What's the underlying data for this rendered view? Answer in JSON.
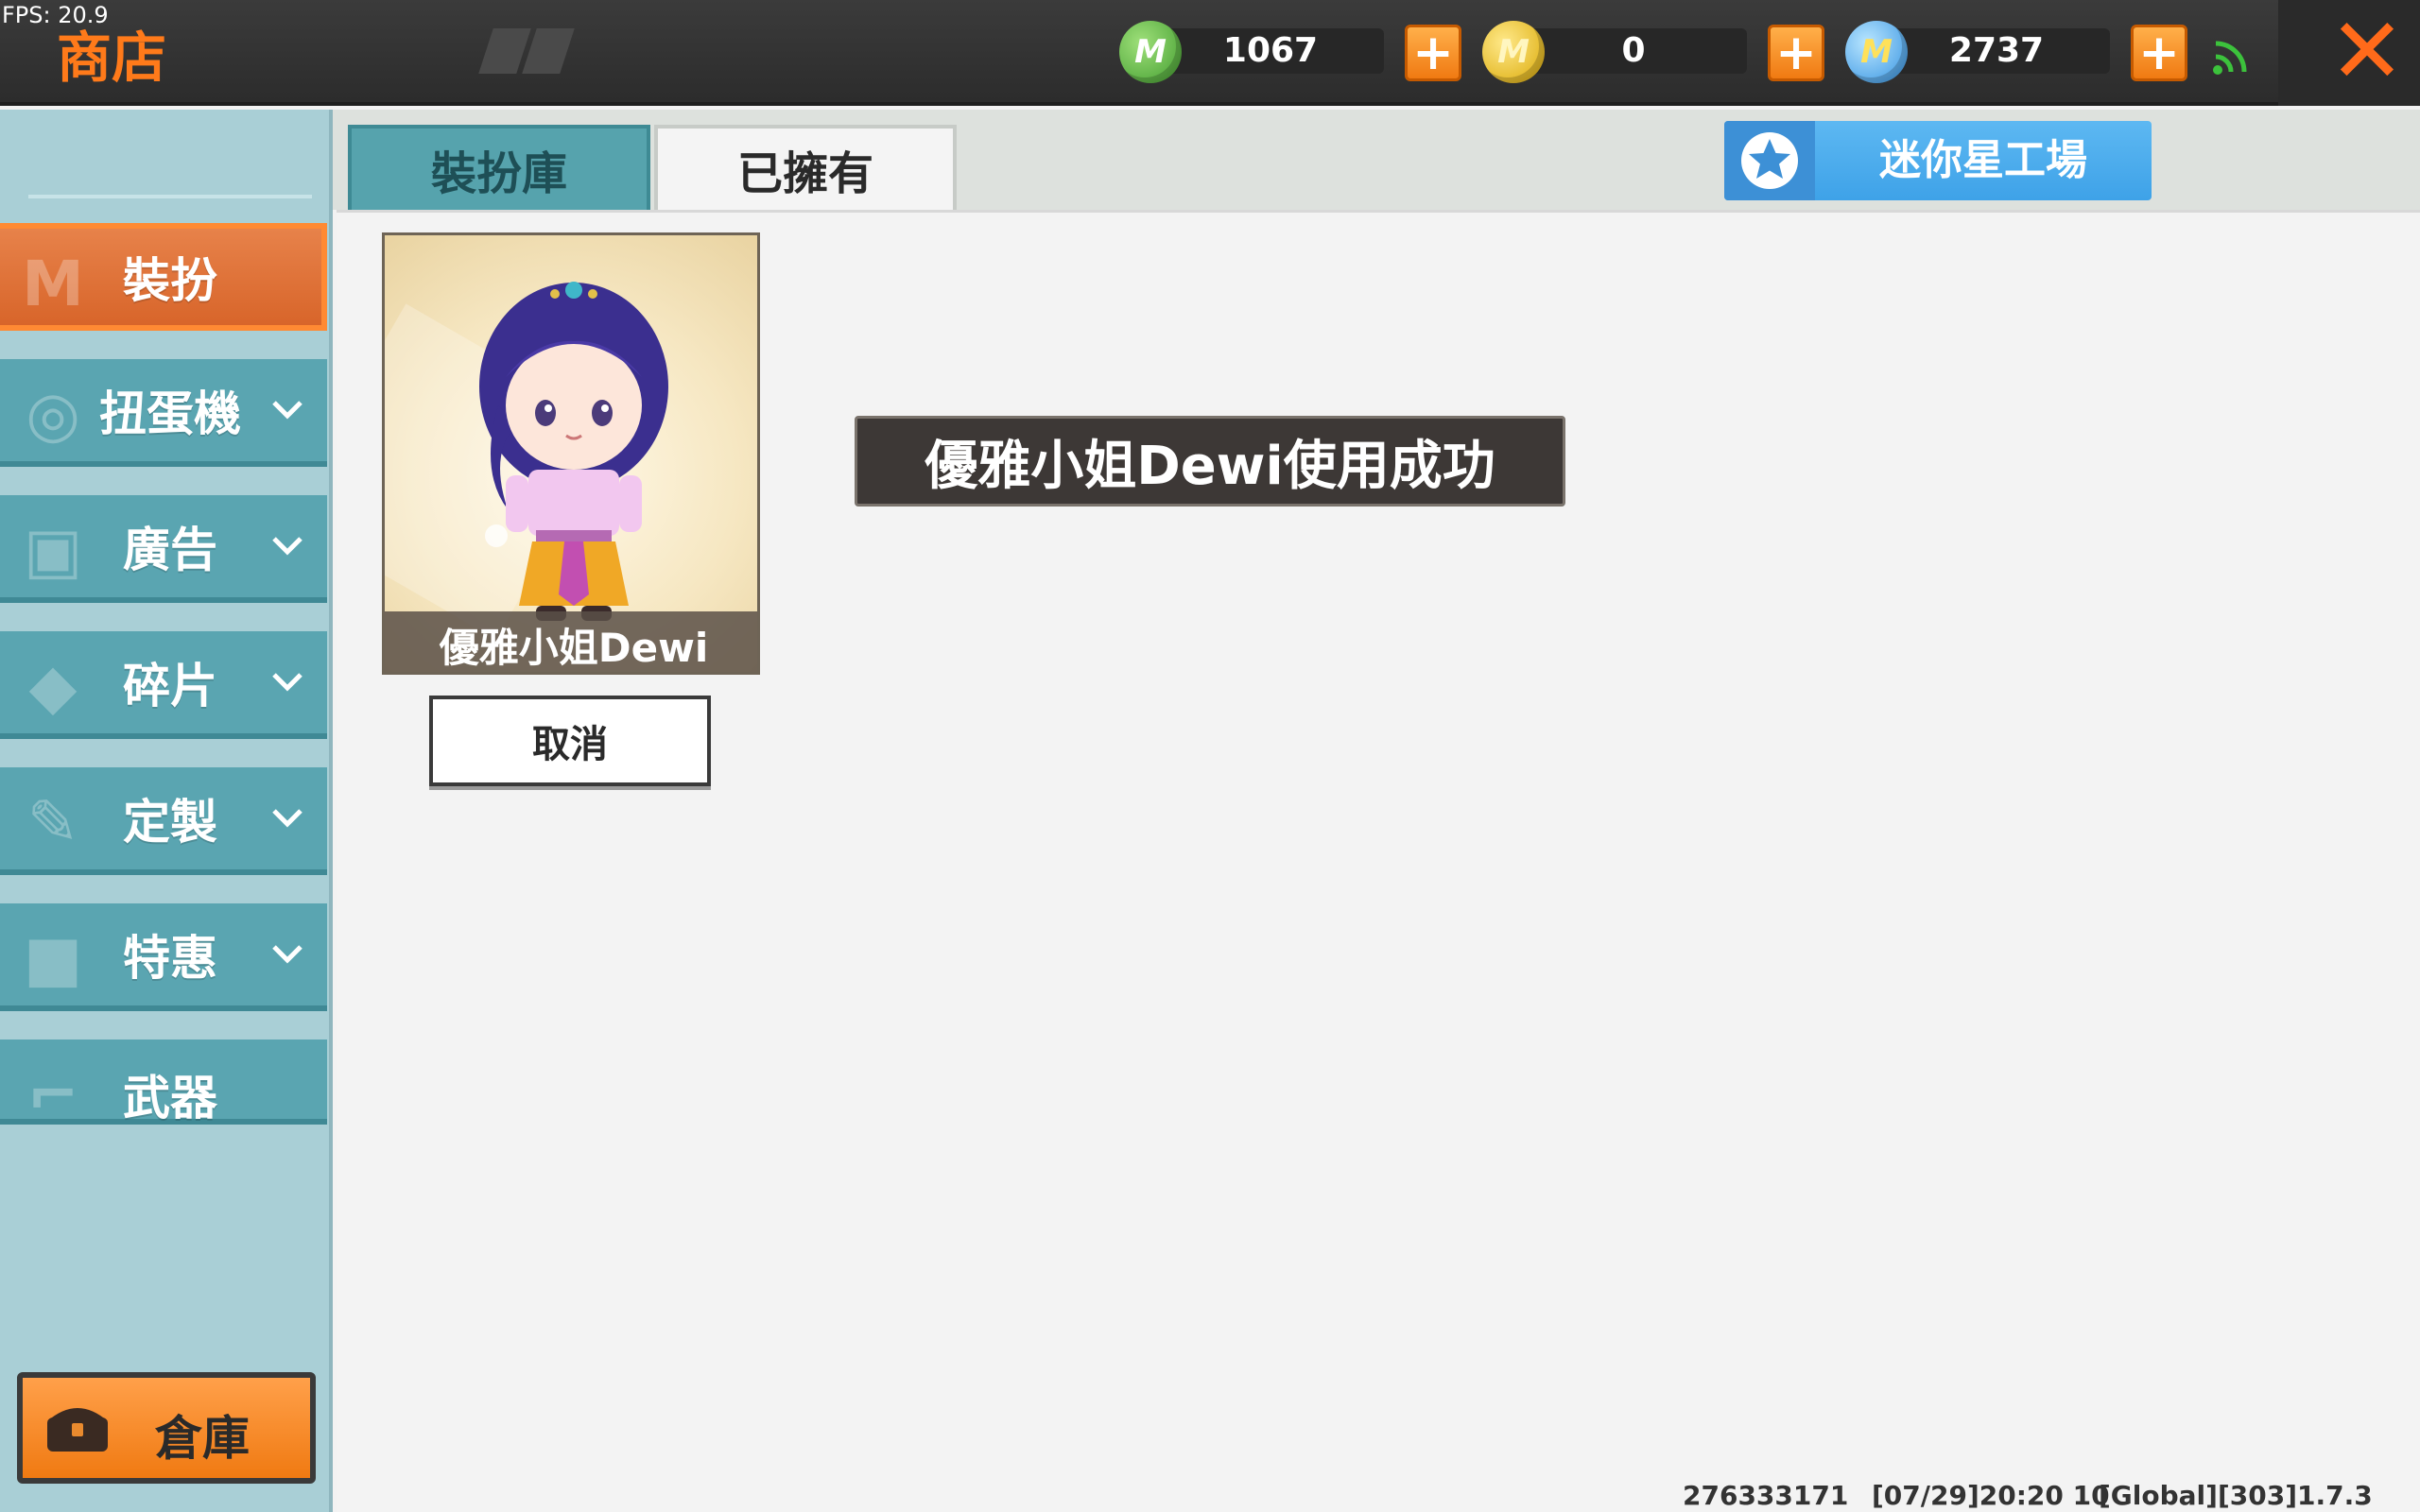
{
  "fps_label": "FPS: 20.9",
  "header": {
    "title": "商店",
    "currencies": [
      {
        "icon": "green-m-gem-icon",
        "value": "1067"
      },
      {
        "icon": "gold-m-coin-icon",
        "value": "0"
      },
      {
        "icon": "blue-m-coin-icon",
        "value": "2737"
      }
    ],
    "close_icon": "close-icon"
  },
  "sidebar": {
    "items": [
      {
        "label": "裝扮",
        "icon": "shirt-icon",
        "active": true
      },
      {
        "label": "扭蛋機",
        "icon": "gacha-icon"
      },
      {
        "label": "廣告",
        "icon": "gift-icon"
      },
      {
        "label": "碎片",
        "icon": "fragment-icon"
      },
      {
        "label": "定製",
        "icon": "pencil-icon"
      },
      {
        "label": "特惠",
        "icon": "box-icon"
      },
      {
        "label": "武器",
        "icon": "gun-icon"
      }
    ],
    "storage_label": "倉庫"
  },
  "tabs": [
    {
      "label": "裝扮庫"
    },
    {
      "label": "已擁有",
      "selected": true
    }
  ],
  "workshop_label": "迷你星工場",
  "card": {
    "name": "優雅小姐Dewi",
    "cancel_label": "取消"
  },
  "toast": "優雅小姐Dewi使用成功",
  "footer": {
    "uid": "276333171",
    "timestamp": "[07/29]20:20 10",
    "version": "[Global][303]1.7.3"
  },
  "colors": {
    "accent_orange": "#ff7a1a",
    "sidebar_teal": "#5aa5b1",
    "workshop_blue": "#3ea2e8"
  }
}
